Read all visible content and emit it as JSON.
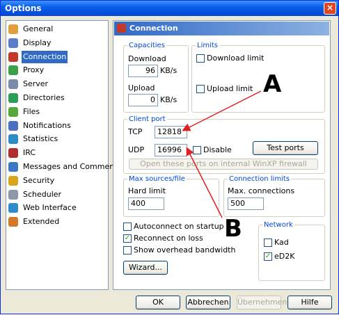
{
  "window": {
    "title": "Options",
    "close": "×"
  },
  "sidebar": {
    "items": [
      {
        "label": "General",
        "icon": "gear-icon",
        "color": "#E1A03C"
      },
      {
        "label": "Display",
        "icon": "display-icon",
        "color": "#5B7FC7"
      },
      {
        "label": "Connection",
        "icon": "plug-icon",
        "color": "#C2392B"
      },
      {
        "label": "Proxy",
        "icon": "proxy-icon",
        "color": "#3CA04B"
      },
      {
        "label": "Server",
        "icon": "server-icon",
        "color": "#7A8BA8"
      },
      {
        "label": "Directories",
        "icon": "folder-icon",
        "color": "#2E9D58"
      },
      {
        "label": "Files",
        "icon": "files-icon",
        "color": "#56A83A"
      },
      {
        "label": "Notifications",
        "icon": "notification-icon",
        "color": "#4C6FBF"
      },
      {
        "label": "Statistics",
        "icon": "statistics-icon",
        "color": "#2D8EC6"
      },
      {
        "label": "IRC",
        "icon": "irc-icon",
        "color": "#B03030"
      },
      {
        "label": "Messages and Comments",
        "icon": "messages-icon",
        "color": "#3E77C1"
      },
      {
        "label": "Security",
        "icon": "lock-icon",
        "color": "#D9A41E"
      },
      {
        "label": "Scheduler",
        "icon": "calendar-icon",
        "color": "#8C97A8"
      },
      {
        "label": "Web Interface",
        "icon": "globe-icon",
        "color": "#2F8BC9"
      },
      {
        "label": "Extended",
        "icon": "extended-icon",
        "color": "#D3792A"
      }
    ],
    "selected": "Connection"
  },
  "panel": {
    "title": "Connection",
    "capacities": {
      "legend": "Capacities",
      "download_label": "Download",
      "download_value": "96",
      "download_unit": "KB/s",
      "upload_label": "Upload",
      "upload_value": "0",
      "upload_unit": "KB/s"
    },
    "limits": {
      "legend": "Limits",
      "download_limit": "Download limit",
      "upload_limit": "Upload limit"
    },
    "client_port": {
      "legend": "Client port",
      "tcp_label": "TCP",
      "tcp_value": "12818",
      "udp_label": "UDP",
      "udp_value": "16996",
      "disable_label": "Disable",
      "test_ports": "Test ports",
      "firewall_button": "Open these ports on internal WinXP firewall"
    },
    "max_sources": {
      "legend": "Max sources/file",
      "hard_limit_label": "Hard limit",
      "hard_limit_value": "400"
    },
    "connection_limits": {
      "legend": "Connection limits",
      "max_connections_label": "Max. connections",
      "max_connections_value": "500"
    },
    "options": {
      "autoconnect": "Autoconnect on startup",
      "reconnect": "Reconnect on loss",
      "overhead": "Show overhead bandwidth"
    },
    "network": {
      "legend": "Network",
      "kad": "Kad",
      "ed2k": "eD2K"
    },
    "wizard": "Wizard..."
  },
  "footer": {
    "ok": "OK",
    "abbrechen": "Abbrechen",
    "uebernehmen": "Übernehmen",
    "hilfe": "Hilfe"
  },
  "annotations": {
    "a": "A",
    "b": "B"
  },
  "colors": {
    "accent": "#316AC5",
    "arrow": "#E02020",
    "legend": "#0046D5"
  }
}
